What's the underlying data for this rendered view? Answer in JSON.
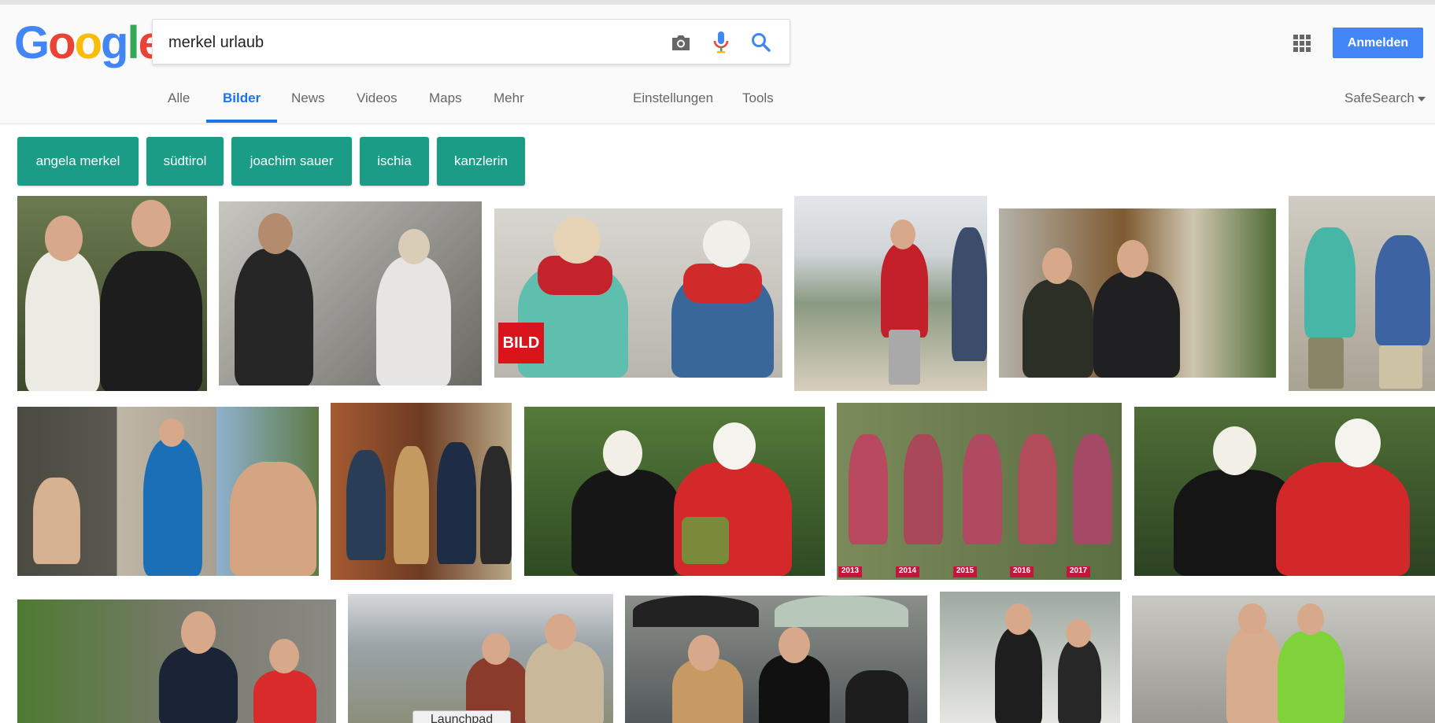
{
  "logo": {
    "letters": [
      "G",
      "o",
      "o",
      "g",
      "l",
      "e"
    ],
    "colors": [
      "#4285f4",
      "#ea4335",
      "#fbbc05",
      "#4285f4",
      "#34a853",
      "#ea4335"
    ]
  },
  "search": {
    "query": "merkel urlaub"
  },
  "header": {
    "signin_label": "Anmelden"
  },
  "tabs": [
    {
      "label": "Alle"
    },
    {
      "label": "Bilder"
    },
    {
      "label": "News"
    },
    {
      "label": "Videos"
    },
    {
      "label": "Maps"
    },
    {
      "label": "Mehr"
    },
    {
      "label": "Einstellungen"
    },
    {
      "label": "Tools"
    }
  ],
  "safesearch_label": "SafeSearch",
  "chips": [
    {
      "label": "angela merkel"
    },
    {
      "label": "südtirol"
    },
    {
      "label": "joachim sauer"
    },
    {
      "label": "ischia"
    },
    {
      "label": "kanzlerin"
    }
  ],
  "thumbs": {
    "bild_logo": "BILD",
    "year_labels": [
      "2013",
      "2014",
      "2015",
      "2016",
      "2017"
    ]
  },
  "tooltip": "Launchpad",
  "colors": {
    "accent": "#1a73e8",
    "chip": "#1a9c87",
    "signin": "#4285f4"
  }
}
